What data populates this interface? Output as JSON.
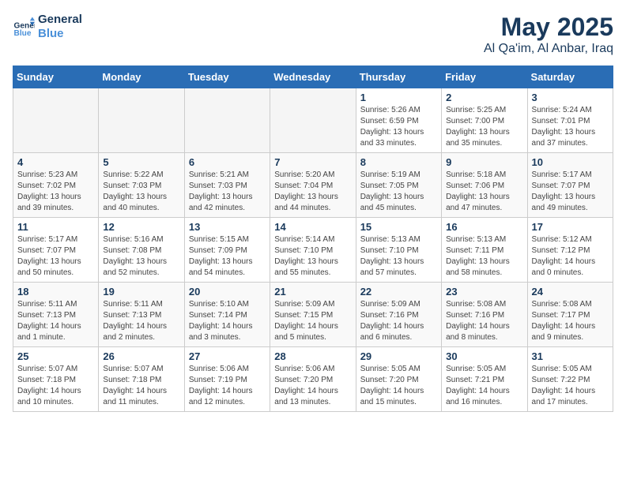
{
  "logo": {
    "line1": "General",
    "line2": "Blue"
  },
  "title": "May 2025",
  "subtitle": "Al Qa'im, Al Anbar, Iraq",
  "weekdays": [
    "Sunday",
    "Monday",
    "Tuesday",
    "Wednesday",
    "Thursday",
    "Friday",
    "Saturday"
  ],
  "weeks": [
    [
      {
        "day": "",
        "info": ""
      },
      {
        "day": "",
        "info": ""
      },
      {
        "day": "",
        "info": ""
      },
      {
        "day": "",
        "info": ""
      },
      {
        "day": "1",
        "info": "Sunrise: 5:26 AM\nSunset: 6:59 PM\nDaylight: 13 hours\nand 33 minutes."
      },
      {
        "day": "2",
        "info": "Sunrise: 5:25 AM\nSunset: 7:00 PM\nDaylight: 13 hours\nand 35 minutes."
      },
      {
        "day": "3",
        "info": "Sunrise: 5:24 AM\nSunset: 7:01 PM\nDaylight: 13 hours\nand 37 minutes."
      }
    ],
    [
      {
        "day": "4",
        "info": "Sunrise: 5:23 AM\nSunset: 7:02 PM\nDaylight: 13 hours\nand 39 minutes."
      },
      {
        "day": "5",
        "info": "Sunrise: 5:22 AM\nSunset: 7:03 PM\nDaylight: 13 hours\nand 40 minutes."
      },
      {
        "day": "6",
        "info": "Sunrise: 5:21 AM\nSunset: 7:03 PM\nDaylight: 13 hours\nand 42 minutes."
      },
      {
        "day": "7",
        "info": "Sunrise: 5:20 AM\nSunset: 7:04 PM\nDaylight: 13 hours\nand 44 minutes."
      },
      {
        "day": "8",
        "info": "Sunrise: 5:19 AM\nSunset: 7:05 PM\nDaylight: 13 hours\nand 45 minutes."
      },
      {
        "day": "9",
        "info": "Sunrise: 5:18 AM\nSunset: 7:06 PM\nDaylight: 13 hours\nand 47 minutes."
      },
      {
        "day": "10",
        "info": "Sunrise: 5:17 AM\nSunset: 7:07 PM\nDaylight: 13 hours\nand 49 minutes."
      }
    ],
    [
      {
        "day": "11",
        "info": "Sunrise: 5:17 AM\nSunset: 7:07 PM\nDaylight: 13 hours\nand 50 minutes."
      },
      {
        "day": "12",
        "info": "Sunrise: 5:16 AM\nSunset: 7:08 PM\nDaylight: 13 hours\nand 52 minutes."
      },
      {
        "day": "13",
        "info": "Sunrise: 5:15 AM\nSunset: 7:09 PM\nDaylight: 13 hours\nand 54 minutes."
      },
      {
        "day": "14",
        "info": "Sunrise: 5:14 AM\nSunset: 7:10 PM\nDaylight: 13 hours\nand 55 minutes."
      },
      {
        "day": "15",
        "info": "Sunrise: 5:13 AM\nSunset: 7:10 PM\nDaylight: 13 hours\nand 57 minutes."
      },
      {
        "day": "16",
        "info": "Sunrise: 5:13 AM\nSunset: 7:11 PM\nDaylight: 13 hours\nand 58 minutes."
      },
      {
        "day": "17",
        "info": "Sunrise: 5:12 AM\nSunset: 7:12 PM\nDaylight: 14 hours\nand 0 minutes."
      }
    ],
    [
      {
        "day": "18",
        "info": "Sunrise: 5:11 AM\nSunset: 7:13 PM\nDaylight: 14 hours\nand 1 minute."
      },
      {
        "day": "19",
        "info": "Sunrise: 5:11 AM\nSunset: 7:13 PM\nDaylight: 14 hours\nand 2 minutes."
      },
      {
        "day": "20",
        "info": "Sunrise: 5:10 AM\nSunset: 7:14 PM\nDaylight: 14 hours\nand 3 minutes."
      },
      {
        "day": "21",
        "info": "Sunrise: 5:09 AM\nSunset: 7:15 PM\nDaylight: 14 hours\nand 5 minutes."
      },
      {
        "day": "22",
        "info": "Sunrise: 5:09 AM\nSunset: 7:16 PM\nDaylight: 14 hours\nand 6 minutes."
      },
      {
        "day": "23",
        "info": "Sunrise: 5:08 AM\nSunset: 7:16 PM\nDaylight: 14 hours\nand 8 minutes."
      },
      {
        "day": "24",
        "info": "Sunrise: 5:08 AM\nSunset: 7:17 PM\nDaylight: 14 hours\nand 9 minutes."
      }
    ],
    [
      {
        "day": "25",
        "info": "Sunrise: 5:07 AM\nSunset: 7:18 PM\nDaylight: 14 hours\nand 10 minutes."
      },
      {
        "day": "26",
        "info": "Sunrise: 5:07 AM\nSunset: 7:18 PM\nDaylight: 14 hours\nand 11 minutes."
      },
      {
        "day": "27",
        "info": "Sunrise: 5:06 AM\nSunset: 7:19 PM\nDaylight: 14 hours\nand 12 minutes."
      },
      {
        "day": "28",
        "info": "Sunrise: 5:06 AM\nSunset: 7:20 PM\nDaylight: 14 hours\nand 13 minutes."
      },
      {
        "day": "29",
        "info": "Sunrise: 5:05 AM\nSunset: 7:20 PM\nDaylight: 14 hours\nand 15 minutes."
      },
      {
        "day": "30",
        "info": "Sunrise: 5:05 AM\nSunset: 7:21 PM\nDaylight: 14 hours\nand 16 minutes."
      },
      {
        "day": "31",
        "info": "Sunrise: 5:05 AM\nSunset: 7:22 PM\nDaylight: 14 hours\nand 17 minutes."
      }
    ]
  ]
}
